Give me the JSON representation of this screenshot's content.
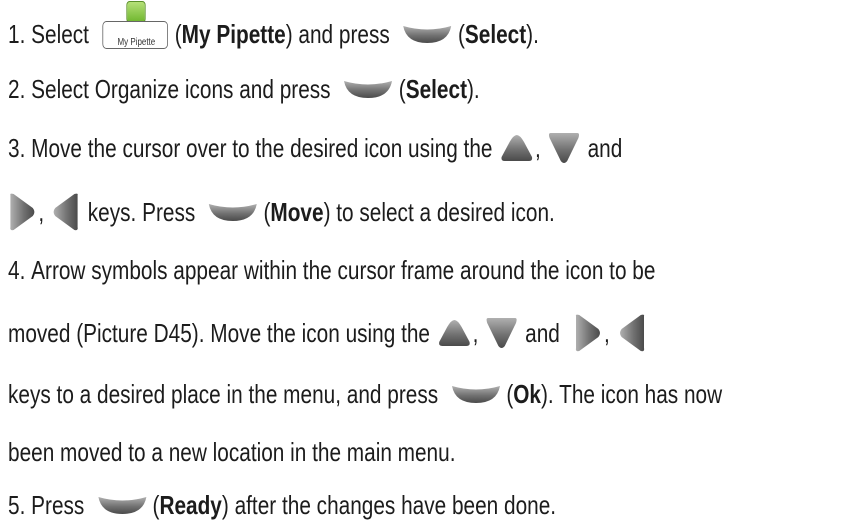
{
  "steps": [
    {
      "num": "1.",
      "t1": "Select",
      "app_label": "My Pipette",
      "t2": "(",
      "b1": "My Pipette",
      "t3": ") and press",
      "t4": "(",
      "b2": "Select",
      "t5": ")."
    },
    {
      "num": "2.",
      "t1": "Select Organize icons and press",
      "t2": "(",
      "b1": "Select",
      "t3": ")."
    },
    {
      "num": "3.",
      "t1": "Move the cursor over to the desired icon using the",
      "t2": ",",
      "t3": "and",
      "t4": ",",
      "t5": "keys. Press",
      "t6": "(",
      "b1": "Move",
      "t7": ") to select a desired icon."
    },
    {
      "num": "4.",
      "t1": "Arrow symbols appear within the cursor frame around the icon to be",
      "t2": "moved (Picture D45).  Move the icon using the",
      "t3": ",",
      "t4": "and",
      "t5": ",",
      "t6": "keys to a desired place in the menu, and press",
      "t7": "(",
      "b1": "Ok",
      "t8": "). The icon has now",
      "t9": "been moved to a new location in the main menu."
    },
    {
      "num": "5.",
      "t1": "Press",
      "t2": "(",
      "b1": "Ready",
      "t3": ") after the changes have been done."
    }
  ],
  "icons": {
    "softkey": "softkey-icon",
    "up": "arrow-up-icon",
    "down": "arrow-down-icon",
    "left": "arrow-left-icon",
    "right": "arrow-right-icon",
    "app": "my-pipette-app-icon"
  },
  "colors": {
    "text": "#1c1c1c",
    "key_gray": "#6b6b6b"
  }
}
